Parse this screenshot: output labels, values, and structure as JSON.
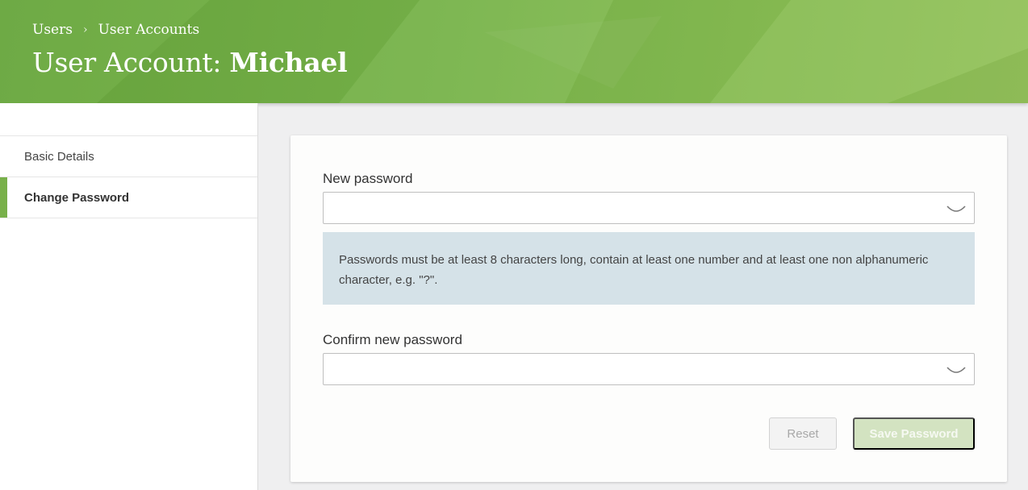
{
  "header": {
    "breadcrumb": [
      "Users",
      "User Accounts"
    ],
    "breadcrumb_separator": "›",
    "title_prefix": "User Account: ",
    "title_name": "Michael"
  },
  "sidebar": {
    "items": [
      {
        "label": "Basic Details",
        "active": false
      },
      {
        "label": "Change Password",
        "active": true
      }
    ]
  },
  "form": {
    "new_password_label": "New password",
    "new_password_value": "",
    "hint": "Passwords must be at least 8 characters long, contain at least one number and at least one non alphanumeric character, e.g. \"?\".",
    "confirm_password_label": "Confirm new password",
    "confirm_password_value": "",
    "reset_label": "Reset",
    "save_label": "Save Password"
  },
  "icons": {
    "password_field": "hidden-password-eye-icon"
  },
  "colors": {
    "accent": "#78b04a",
    "header": "#76b349",
    "hint_bg": "#d5e2e8",
    "save_disabled": "#d3e3c1"
  }
}
